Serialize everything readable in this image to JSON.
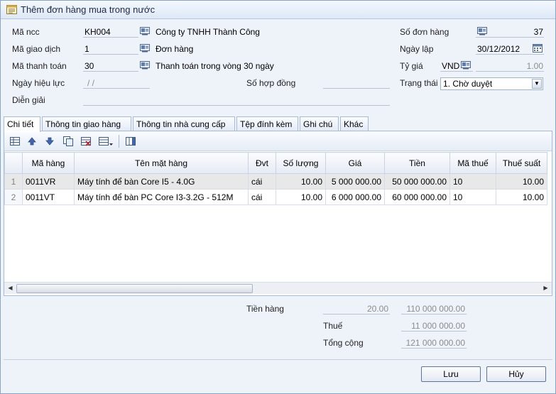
{
  "window": {
    "title": "Thêm đơn hàng mua trong nước",
    "icon": "form-window-icon"
  },
  "form": {
    "supplier_code_label": "Mã ncc",
    "supplier_code": "KH004",
    "supplier_name": "Công ty TNHH Thành Công",
    "transaction_code_label": "Mã giao dịch",
    "transaction_code": "1",
    "transaction_name": "Đơn hàng",
    "payment_code_label": "Mã thanh toán",
    "payment_code": "30",
    "payment_name": "Thanh toán trong vòng 30 ngày",
    "effective_date_label": "Ngày hiệu lực",
    "effective_date": " / /",
    "contract_no_label": "Số hợp đồng",
    "contract_no": "",
    "description_label": "Diễn giải",
    "description": "",
    "order_no_label": "Số đơn hàng",
    "order_no": "37",
    "created_date_label": "Ngày lập",
    "created_date": "30/12/2012",
    "exchange_rate_label": "Tỷ giá",
    "currency": "VND",
    "exchange_rate": "1.00",
    "status_label": "Trạng thái",
    "status": "1. Chờ duyệt"
  },
  "tabs": [
    {
      "label": "Chi tiết",
      "active": true
    },
    {
      "label": "Thông tin giao hàng"
    },
    {
      "label": "Thông tin nhà cung cấp"
    },
    {
      "label": "Tệp đính kèm"
    },
    {
      "label": "Ghi chú"
    },
    {
      "label": "Khác"
    }
  ],
  "toolbar": {
    "icons": [
      "insert-row-icon",
      "move-up-icon",
      "move-down-icon",
      "copy-row-icon",
      "delete-row-icon",
      "grid-options-icon",
      "columns-icon"
    ]
  },
  "grid": {
    "columns": [
      "Mã hàng",
      "Tên mặt hàng",
      "Đvt",
      "Số lượng",
      "Giá",
      "Tiền",
      "Mã thuế",
      "Thuế suất"
    ],
    "rows": [
      {
        "no": "1",
        "code": "0011VR",
        "name": "Máy tính để bàn Core I5 - 4.0G",
        "unit": "cái",
        "qty": "10.00",
        "price": "5 000 000.00",
        "amount": "50 000 000.00",
        "tax_code": "10",
        "tax_rate": "10.00"
      },
      {
        "no": "2",
        "code": "0011VT",
        "name": "Máy tính để bàn PC Core I3-3.2G - 512M",
        "unit": "cái",
        "qty": "10.00",
        "price": "6 000 000.00",
        "amount": "60 000 000.00",
        "tax_code": "10",
        "tax_rate": "10.00"
      }
    ]
  },
  "summary": {
    "subtotal_label": "Tiền hàng",
    "subtotal_qty": "20.00",
    "subtotal_amount": "110 000 000.00",
    "tax_label": "Thuế",
    "tax_amount": "11 000 000.00",
    "total_label": "Tổng cộng",
    "total_amount": "121 000 000.00"
  },
  "buttons": {
    "save": "Lưu",
    "cancel": "Hủy"
  }
}
